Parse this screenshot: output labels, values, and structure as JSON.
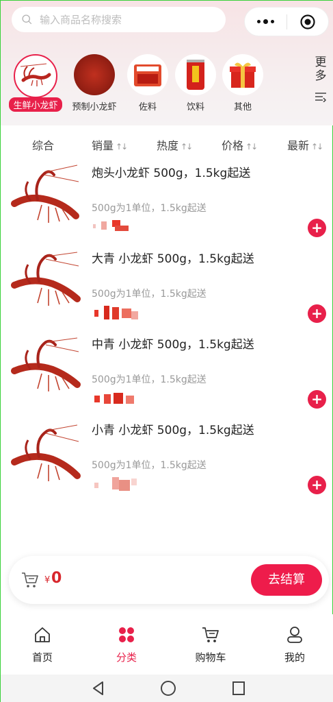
{
  "search": {
    "placeholder": "输入商品名称搜索"
  },
  "categories": [
    {
      "label": "生鲜小龙虾",
      "active": true
    },
    {
      "label": "预制小龙虾",
      "active": false
    },
    {
      "label": "佐料",
      "active": false
    },
    {
      "label": "饮料",
      "active": false
    },
    {
      "label": "其他",
      "active": false
    }
  ],
  "more_label": "更多",
  "sort": [
    "综合",
    "销量",
    "热度",
    "价格",
    "最新"
  ],
  "products": [
    {
      "name": "炮头小龙虾 500g，1.5kg起送",
      "desc": "500g为1单位，1.5kg起送"
    },
    {
      "name": "大青 小龙虾 500g，1.5kg起送",
      "desc": "500g为1单位，1.5kg起送"
    },
    {
      "name": "中青 小龙虾 500g，1.5kg起送",
      "desc": "500g为1单位，1.5kg起送"
    },
    {
      "name": "小青 小龙虾 500g，1.5kg起送",
      "desc": "500g为1单位，1.5kg起送"
    }
  ],
  "cart": {
    "currency": "¥",
    "amount": "0",
    "checkout_label": "去结算"
  },
  "tabs": [
    {
      "label": "首页",
      "icon": "home-icon"
    },
    {
      "label": "分类",
      "icon": "category-icon"
    },
    {
      "label": "购物车",
      "icon": "cart-icon"
    },
    {
      "label": "我的",
      "icon": "user-icon"
    }
  ],
  "colors": {
    "accent": "#e8204a",
    "price": "#d8262c"
  }
}
